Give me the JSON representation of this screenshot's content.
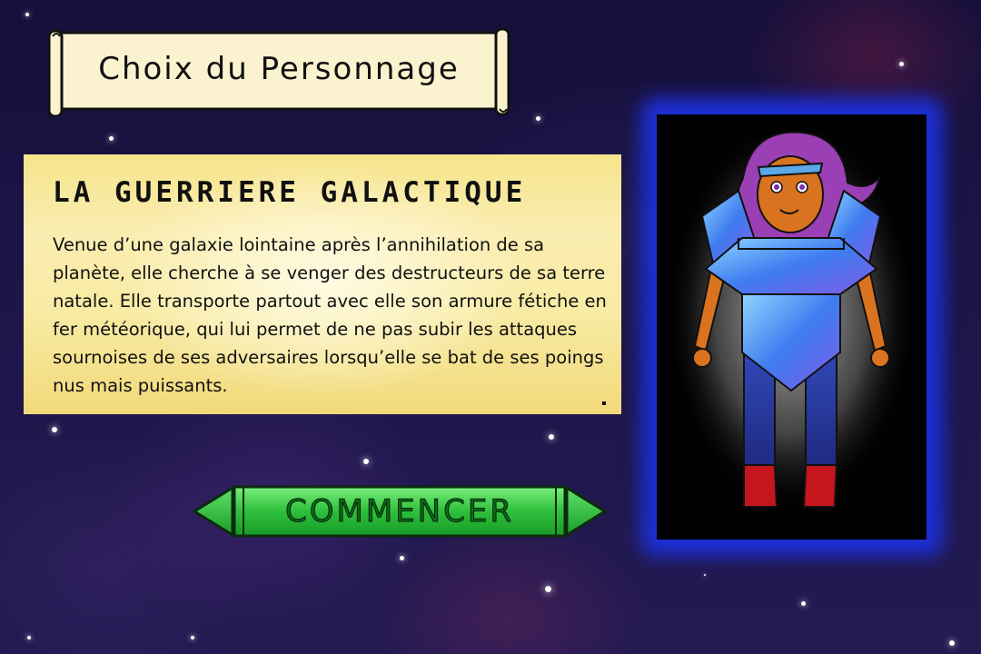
{
  "screen": {
    "title": "Choix du Personnage"
  },
  "character": {
    "name": "LA GUERRIERE GALACTIQUE",
    "description": "Venue d’une galaxie lointaine après l’annihilation de sa planète, elle cherche à se venger des destructeurs de sa terre natale. Elle transporte partout avec elle son armure fétiche en fer météorique, qui lui permet de ne pas subir les attaques sournoises de ses adversaires lorsqu’elle se bat de ses poings nus mais puissants."
  },
  "actions": {
    "start_label": "COMMENCER",
    "prev_icon": "arrow-left-icon",
    "next_icon": "arrow-right-icon"
  },
  "colors": {
    "background": "#1a1240",
    "panel": "#f8eba4",
    "button_green": "#2fbf3c",
    "portrait_glow": "#1c2fd8"
  }
}
